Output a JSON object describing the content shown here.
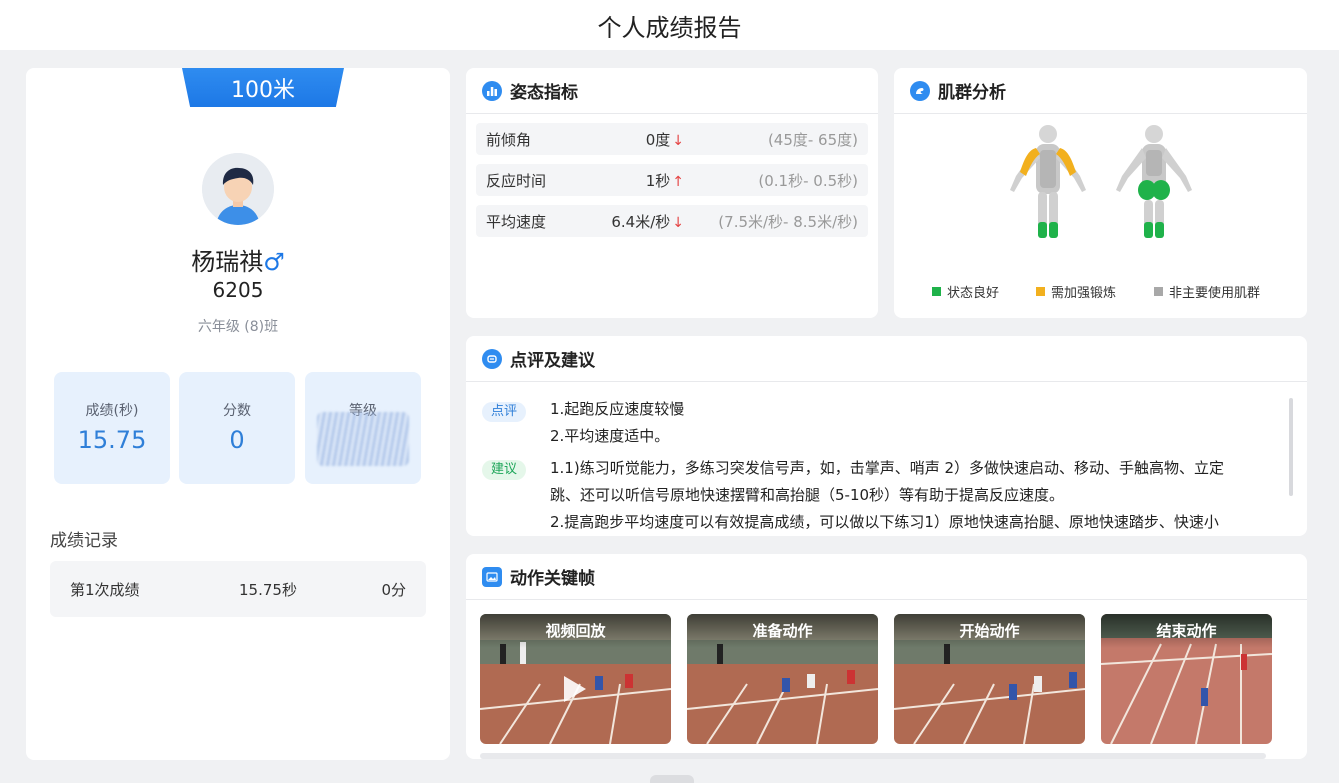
{
  "page": {
    "title": "个人成绩报告"
  },
  "student": {
    "event": "100米",
    "name": "杨瑞祺",
    "gender_symbol": "♂",
    "id": "6205",
    "class": "六年级 (8)班"
  },
  "stats": [
    {
      "label": "成绩(秒)",
      "value": "15.75"
    },
    {
      "label": "分数",
      "value": "0"
    },
    {
      "label": "等级",
      "value": ""
    }
  ],
  "records": {
    "title": "成绩记录",
    "rows": [
      {
        "name": "第1次成绩",
        "time": "15.75秒",
        "score": "0分"
      }
    ]
  },
  "posture": {
    "title": "姿态指标",
    "rows": [
      {
        "name": "前倾角",
        "value": "0度",
        "arrow": "↓",
        "range": "(45度- 65度)"
      },
      {
        "name": "反应时间",
        "value": "1秒",
        "arrow": "↑",
        "range": "(0.1秒- 0.5秒)"
      },
      {
        "name": "平均速度",
        "value": "6.4米/秒",
        "arrow": "↓",
        "range": "(7.5米/秒- 8.5米/秒)"
      }
    ]
  },
  "muscle": {
    "title": "肌群分析",
    "legend": [
      {
        "label": "状态良好",
        "color": "#1fb24a"
      },
      {
        "label": "需加强锻炼",
        "color": "#f2b01e"
      },
      {
        "label": "非主要使用肌群",
        "color": "#a8a8a8"
      }
    ]
  },
  "review": {
    "title": "点评及建议",
    "comment_tag": "点评",
    "comment_lines": [
      "1.起跑反应速度较慢",
      "2.平均速度适中。"
    ],
    "advice_tag": "建议",
    "advice_lines": [
      "1.1)练习听觉能力，多练习突发信号声，如，击掌声、哨声 2）多做快速启动、移动、手触高物、立定",
      "跳、还可以听信号原地快速摆臂和高抬腿（5-10秒）等有助于提高反应速度。",
      "2.提高跑步平均速度可以有效提高成绩，可以做以下练习1）原地快速高抬腿、原地快速踏步、快速小"
    ]
  },
  "frames": {
    "title": "动作关键帧",
    "items": [
      {
        "label": "视频回放"
      },
      {
        "label": "准备动作"
      },
      {
        "label": "开始动作"
      },
      {
        "label": "结束动作"
      }
    ]
  },
  "colors": {
    "accent": "#2f8cf0",
    "stat_bg": "#e7f1fd",
    "down_arrow": "#e54545"
  }
}
